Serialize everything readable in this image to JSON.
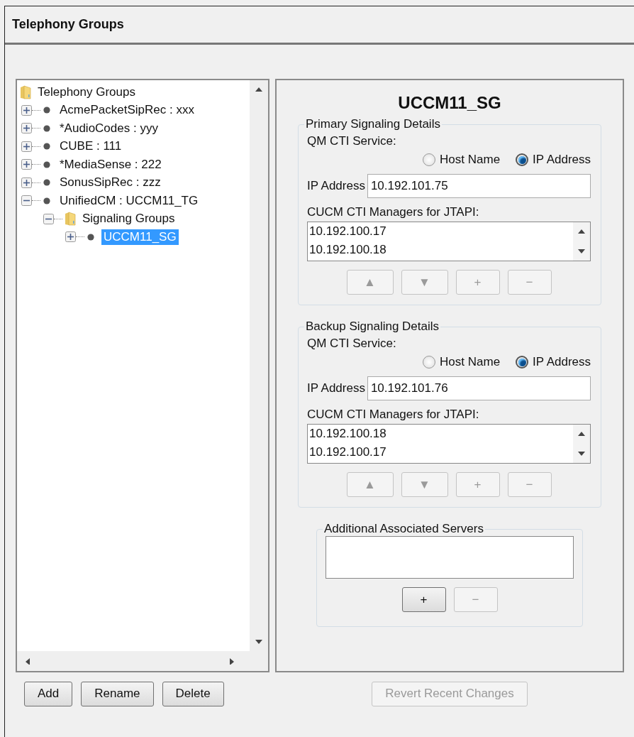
{
  "window": {
    "title": "Telephony Groups"
  },
  "tree": {
    "items": [
      {
        "label": "Telephony Groups",
        "kind": "folder",
        "selected": false,
        "children": [
          {
            "label": "AcmePacketSipRec : xxx",
            "kind": "node",
            "expanded": false,
            "selected": false
          },
          {
            "label": "*AudioCodes : yyy",
            "kind": "node",
            "expanded": false,
            "selected": false
          },
          {
            "label": "CUBE : 111",
            "kind": "node",
            "expanded": false,
            "selected": false
          },
          {
            "label": "*MediaSense : 222",
            "kind": "node",
            "expanded": false,
            "selected": false
          },
          {
            "label": "SonusSipRec : zzz",
            "kind": "node",
            "expanded": false,
            "selected": false
          },
          {
            "label": "UnifiedCM : UCCM11_TG",
            "kind": "node",
            "expanded": true,
            "selected": false,
            "children": [
              {
                "label": "Signaling Groups",
                "kind": "folder",
                "expanded": true,
                "selected": false,
                "children": [
                  {
                    "label": "UCCM11_SG",
                    "kind": "node",
                    "expanded": false,
                    "selected": true
                  }
                ]
              }
            ]
          }
        ]
      }
    ]
  },
  "tree_buttons": [
    {
      "label": "Add",
      "disabled": false
    },
    {
      "label": "Rename",
      "disabled": false
    },
    {
      "label": "Delete",
      "disabled": false
    }
  ],
  "detail": {
    "title": "UCCM11_SG",
    "sections": [
      {
        "title": "Primary Signaling Details",
        "service_label": "QM CTI Service:",
        "options": [
          {
            "label": "Host Name",
            "selected": false
          },
          {
            "label": "IP Address",
            "selected": true
          }
        ],
        "ip_label": "IP Address",
        "ip_value": "10.192.101.75",
        "managers_label": "CUCM CTI Managers for JTAPI:",
        "managers": [
          "10.192.100.17",
          "10.192.100.18"
        ],
        "buttons": [
          {
            "label": "▲",
            "disabled": true
          },
          {
            "label": "▼",
            "disabled": true
          },
          {
            "label": "+",
            "disabled": true
          },
          {
            "label": "−",
            "disabled": true
          }
        ]
      },
      {
        "title": "Backup Signaling Details",
        "service_label": "QM CTI Service:",
        "options": [
          {
            "label": "Host Name",
            "selected": false
          },
          {
            "label": "IP Address",
            "selected": true
          }
        ],
        "ip_label": "IP Address",
        "ip_value": "10.192.101.76",
        "managers_label": "CUCM CTI Managers for JTAPI:",
        "managers": [
          "10.192.100.18",
          "10.192.100.17"
        ],
        "buttons": [
          {
            "label": "▲",
            "disabled": true
          },
          {
            "label": "▼",
            "disabled": true
          },
          {
            "label": "+",
            "disabled": true
          },
          {
            "label": "−",
            "disabled": true
          }
        ]
      }
    ],
    "additional": {
      "title": "Additional Associated Servers",
      "buttons": [
        {
          "label": "+",
          "disabled": false
        },
        {
          "label": "−",
          "disabled": true
        }
      ]
    },
    "revert": {
      "label": "Revert Recent Changes",
      "disabled": true
    }
  }
}
